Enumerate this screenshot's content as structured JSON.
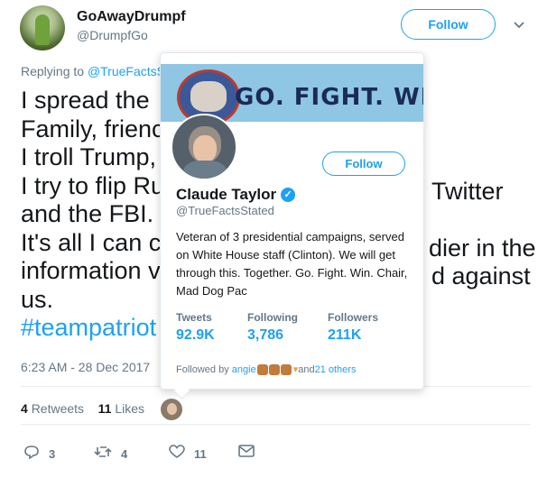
{
  "author": {
    "display_name": "GoAwayDrumpf",
    "handle": "@DrumpfGo",
    "follow_label": "Follow"
  },
  "reply": {
    "prefix": "Replying to ",
    "mention": "@TrueFactsS"
  },
  "tweet": {
    "lines": [
      "I spread the",
      "Family, frienc",
      "I troll Trump,",
      "I try to flip Ru",
      "and the FBI.",
      "It's all I can c",
      "information v",
      "us."
    ],
    "right_fragments": {
      "line4": "Twitter",
      "line6": "dier in the",
      "line7": "d against"
    },
    "hashtag": "#teampatriot",
    "timestamp": "6:23 AM - 28 Dec 2017"
  },
  "stats": {
    "retweets_count": "4",
    "retweets_label": "Retweets",
    "likes_count": "11",
    "likes_label": "Likes"
  },
  "actions": {
    "reply_count": "3",
    "retweet_count": "4",
    "like_count": "11"
  },
  "hover_card": {
    "banner_text": "GO. FIGHT. WIN.",
    "banner_color": "#8ec6e4",
    "follow_label": "Follow",
    "name": "Claude Taylor",
    "handle": "@TrueFactsStated",
    "bio": "Veteran of 3 presidential campaigns, served on White House staff (Clinton). We will get through this. Together. Go. Fight. Win. Chair, Mad Dog Pac",
    "tweets_label": "Tweets",
    "tweets_value": "92.9K",
    "following_label": "Following",
    "following_value": "3,786",
    "followers_label": "Followers",
    "followers_value": "211K",
    "followed_by_prefix": "Followed by ",
    "followed_by_user": "angie",
    "followed_by_and": " and ",
    "followed_by_others": "21 others"
  },
  "colors": {
    "accent": "#1da1f2",
    "muted": "#657786",
    "text": "#14171a"
  }
}
